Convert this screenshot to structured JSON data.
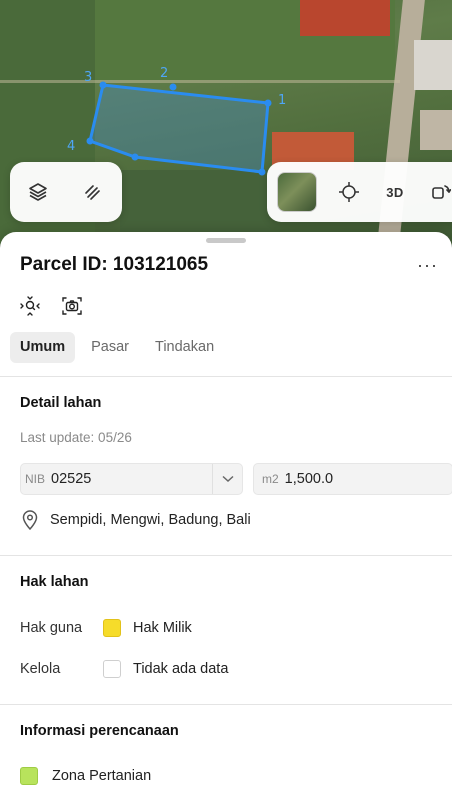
{
  "map": {
    "parcel_vertices": [
      "1",
      "2",
      "3",
      "4"
    ],
    "satellite_thumb": "satellite-thumbnail",
    "controls": {
      "layers_icon": "layers-icon",
      "measure_icon": "ruler-icon",
      "locate_icon": "crosshair-icon",
      "mode_3d_label": "3D",
      "rotate_icon": "rotate-icon"
    },
    "colors": {
      "parcel_outline": "#2a8cf0",
      "parcel_fill": "#3f86c8"
    }
  },
  "sheet": {
    "title": "Parcel ID: 103121065",
    "more_label": "···",
    "tabs": [
      {
        "label": "Umum",
        "active": true
      },
      {
        "label": "Pasar",
        "active": false
      },
      {
        "label": "Tindakan",
        "active": false
      }
    ],
    "detail": {
      "title": "Detail lahan",
      "last_update": "Last update: 05/26",
      "nib_prefix": "NIB",
      "nib_value": "02525",
      "area_prefix": "m2",
      "area_value": "1,500.0",
      "location": "Sempidi, Mengwi, Badung, Bali"
    },
    "rights": {
      "title": "Hak lahan",
      "rows": [
        {
          "key": "Hak guna",
          "value": "Hak Milik",
          "swatch": "#f6dc2a"
        },
        {
          "key": "Kelola",
          "value": "Tidak ada data",
          "swatch": "#ffffff"
        }
      ]
    },
    "planning": {
      "title": "Informasi perencanaan",
      "zone": "Zona Pertanian",
      "zone_color": "#b8e35c"
    }
  }
}
